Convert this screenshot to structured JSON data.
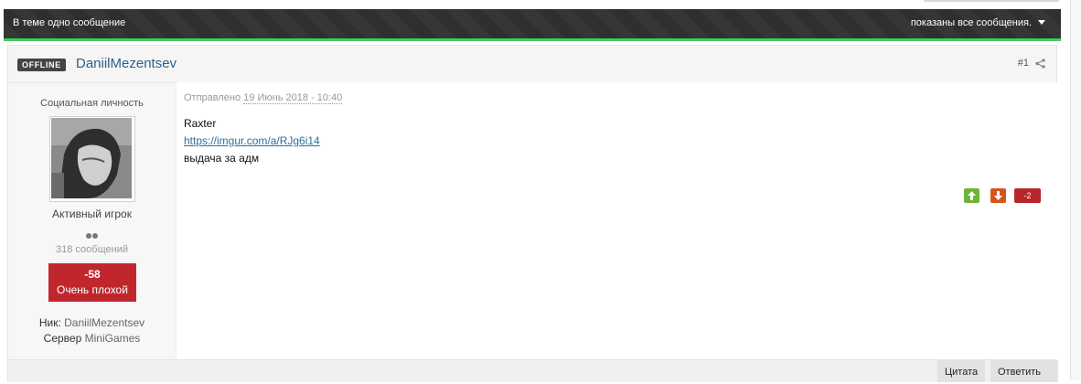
{
  "topic_bar": {
    "summary": "В теме одно сообщение",
    "filter": "показаны все сообщения."
  },
  "post": {
    "status": "OFFLINE",
    "author": "DaniilMezentsev",
    "number": "#1",
    "author_info": {
      "member_title": "Социальная личность",
      "group": "Активный игрок",
      "post_count": "318 сообщений",
      "reputation_value": "-58",
      "reputation_label": "Очень плохой",
      "nick_label": "Ник:",
      "nick_value": "DaniilMezentsev",
      "server_label": "Сервер",
      "server_value": "MiniGames"
    },
    "posted_prefix": "Отправлено",
    "posted_date": "19 Июнь 2018 - 10:40",
    "content": {
      "line1": "Raxter",
      "link": "https://imgur.com/a/RJg6i14",
      "line3": "выдача за адм"
    },
    "reputation_score": "-2",
    "controls": {
      "quote": "Цитата",
      "reply": "Ответить"
    }
  },
  "colors": {
    "accent_green": "#3ccf5a",
    "rep_negative": "#c0272d",
    "vote_up": "#6db436",
    "vote_down": "#d6541c",
    "author_link": "#2b5f8a"
  }
}
